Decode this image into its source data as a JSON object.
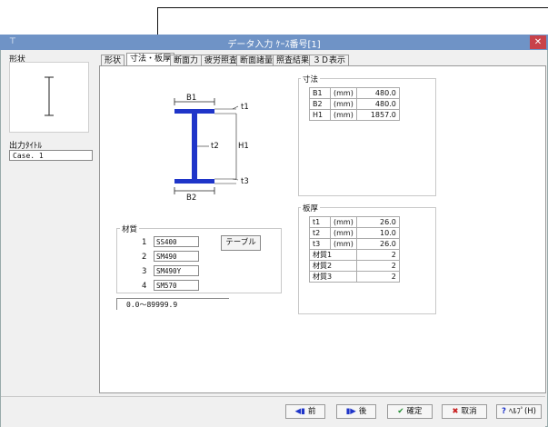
{
  "window": {
    "title": "データ入力 ｹｰｽ番号[1]",
    "app_icon": "app-icon",
    "close_label": "✕"
  },
  "sidebar": {
    "shape_label": "形状",
    "output_title_label": "出力ﾀｲﾄﾙ",
    "output_title_value": "Case. 1"
  },
  "tabs": [
    {
      "label": "形状",
      "active": false
    },
    {
      "label": "寸法・板厚",
      "active": true
    },
    {
      "label": "断面力",
      "active": false
    },
    {
      "label": "疲労照査",
      "active": false
    },
    {
      "label": "断面諸量",
      "active": false
    },
    {
      "label": "照査結果",
      "active": false
    },
    {
      "label": "３Ｄ表示",
      "active": false
    }
  ],
  "diagram": {
    "b1": "B1",
    "b2": "B2",
    "t1": "t1",
    "t2": "t2",
    "t3": "t3",
    "h1": "H1"
  },
  "material": {
    "label": "材質",
    "rows": [
      {
        "no": "1",
        "value": "SS400"
      },
      {
        "no": "2",
        "value": "SM490"
      },
      {
        "no": "3",
        "value": "SM490Y"
      },
      {
        "no": "4",
        "value": "SM570"
      }
    ],
    "table_button": "テーブル"
  },
  "range_text": "0.0～89999.9",
  "dimensions": {
    "label": "寸法",
    "rows": [
      {
        "name": "B1",
        "unit": "(mm)",
        "value": "480.0"
      },
      {
        "name": "B2",
        "unit": "(mm)",
        "value": "480.0"
      },
      {
        "name": "H1",
        "unit": "(mm)",
        "value": "1857.0"
      }
    ]
  },
  "thickness": {
    "label": "板厚",
    "rows": [
      {
        "name": "t1",
        "unit": "(mm)",
        "value": "26.0"
      },
      {
        "name": "t2",
        "unit": "(mm)",
        "value": "10.0"
      },
      {
        "name": "t3",
        "unit": "(mm)",
        "value": "26.0"
      },
      {
        "name": "材質1",
        "unit": "",
        "value": "2"
      },
      {
        "name": "材質2",
        "unit": "",
        "value": "2"
      },
      {
        "name": "材質3",
        "unit": "",
        "value": "2"
      }
    ]
  },
  "buttons": {
    "prev": "前",
    "next": "後",
    "ok": "確定",
    "cancel": "取消",
    "help": "ﾍﾙﾌﾟ(H)"
  },
  "colors": {
    "titlebar": "#6f93c6",
    "beam": "#1f35c9",
    "close": "#c8424a"
  }
}
